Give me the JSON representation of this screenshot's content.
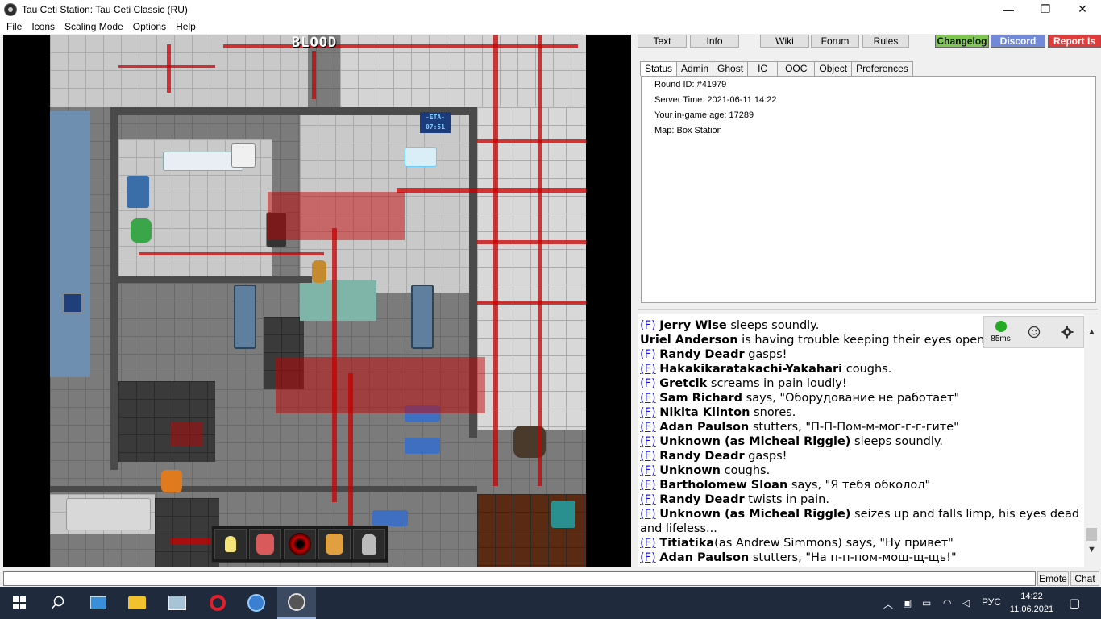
{
  "window": {
    "title": "Tau Ceti Station: Tau Ceti Classic (RU)",
    "minimize": "—",
    "maximize": "❐",
    "close": "✕"
  },
  "menu": [
    "File",
    "Icons",
    "Scaling Mode",
    "Options",
    "Help"
  ],
  "game": {
    "overlay_text": "BLOOD",
    "eta_label": "-ETA-",
    "eta_time": "07:51"
  },
  "top_buttons": {
    "text": "Text",
    "info": "Info",
    "wiki": "Wiki",
    "forum": "Forum",
    "rules": "Rules",
    "changelog": "Changelog",
    "discord": "Discord",
    "report": "Report Is"
  },
  "colors": {
    "changelog": "#7ec850",
    "discord": "#7289da",
    "report": "#e23b3b",
    "link": "#1a1aee",
    "ping": "#22aa22"
  },
  "status_tabs": [
    "Status",
    "Admin",
    "Ghost",
    "IC",
    "OOC",
    "Object",
    "Preferences"
  ],
  "status": {
    "round_id": "Round ID: #41979",
    "server_time": "Server Time: 2021-06-11 14:22",
    "ingame_age": "Your in-game age: 17289",
    "map": "Map: Box Station"
  },
  "chat_widgets": {
    "ping": "85ms",
    "emoji_icon": "smiley-icon",
    "settings_icon": "gear-icon"
  },
  "chat": [
    {
      "prefix": "(F)",
      "name": "Jerry Wise",
      "text": " sleeps soundly."
    },
    {
      "prefix": "",
      "name": "Uriel Anderson",
      "text": " is having trouble keeping their eyes open."
    },
    {
      "prefix": "(F)",
      "name": "Randy Deadr",
      "text": " gasps!"
    },
    {
      "prefix": "(F)",
      "name": "Hakakikaratakachi-Yakahari",
      "text": " coughs."
    },
    {
      "prefix": "(F)",
      "name": "Gretcik",
      "text": " screams in pain loudly!"
    },
    {
      "prefix": "(F)",
      "name": "Sam Richard",
      "text": " says, \"Оборудование не работает\""
    },
    {
      "prefix": "(F)",
      "name": "Nikita Klinton",
      "text": " snores."
    },
    {
      "prefix": "(F)",
      "name": "Adan Paulson",
      "text": " stutters, \"П-П-Пом-м-мог-г-г-гите\""
    },
    {
      "prefix": "(F)",
      "name": "Unknown (as Micheal Riggle)",
      "text": " sleeps soundly."
    },
    {
      "prefix": "(F)",
      "name": "Randy Deadr",
      "text": " gasps!"
    },
    {
      "prefix": "(F)",
      "name": "Unknown",
      "text": " coughs."
    },
    {
      "prefix": "(F)",
      "name": "Bartholomew Sloan",
      "text": " says, \"Я тебя обколол\""
    },
    {
      "prefix": "(F)",
      "name": "Randy Deadr",
      "text": " twists in pain."
    },
    {
      "prefix": "(F)",
      "name": "Unknown (as Micheal Riggle)",
      "text": " seizes up and falls limp, his eyes dead and lifeless..."
    },
    {
      "prefix": "(F)",
      "name": "Titiatika",
      "text": "(as Andrew Simmons) says, \"Ну привет\""
    },
    {
      "prefix": "(F)",
      "name": "Adan Paulson",
      "text": " stutters, \"На п-п-пом-мощ-щ-щь!\""
    }
  ],
  "input_bar": {
    "command_value": "",
    "emote": "Emote",
    "chat": "Chat"
  },
  "taskbar": {
    "start_icon": "windows-start-icon",
    "search_icon": "search-icon",
    "apps": [
      "control-panel-icon",
      "file-explorer-icon",
      "photos-icon",
      "opera-icon",
      "byond-icon",
      "tau-ceti-icon"
    ],
    "language": "РУС",
    "time": "14:22",
    "date": "11.06.2021"
  }
}
